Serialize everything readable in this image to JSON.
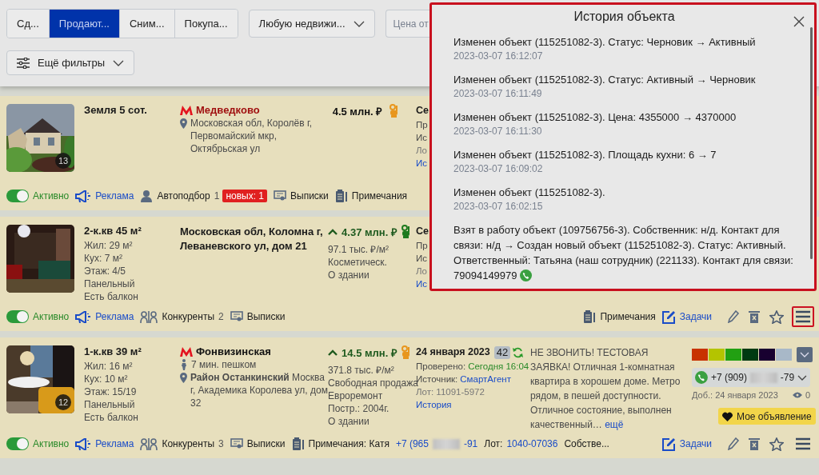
{
  "filters": {
    "tabs": [
      {
        "label": "Сд...",
        "selected": false
      },
      {
        "label": "Продают...",
        "selected": true
      },
      {
        "label": "Сним...",
        "selected": false
      },
      {
        "label": "Покупа...",
        "selected": false
      }
    ],
    "property_type": "Любую недвижи...",
    "price_from": {
      "placeholder": "Цена от"
    },
    "more_filters": "Ещё фильтры"
  },
  "listings": [
    {
      "photo": {
        "kind": "picture",
        "count": "13"
      },
      "title": "Земля 5 сот.",
      "location": {
        "metro": {
          "name": "Медведково",
          "color": "#a01010"
        },
        "address": {
          "kind": "pin",
          "text": "Московская обл, Королёв г, Первомайский мкр, Октябрьская ул"
        }
      },
      "price": {
        "value": "4.5 млн. ₽",
        "rising": false,
        "hand": {
          "color": "#e8961e"
        }
      },
      "info": {
        "date": "Се",
        "checked_label": "Пр",
        "source_label": "Ис",
        "lot": "Ло",
        "history": "Ис"
      },
      "footer": {
        "left": [
          {
            "kind": "status",
            "label": "Активно",
            "on": true
          },
          {
            "kind": "ads",
            "label": "Реклама"
          },
          {
            "kind": "autoselect",
            "label": "Автоподбор",
            "count": "1",
            "badge": "новых: 1"
          },
          {
            "kind": "statements",
            "label": "Выписки"
          },
          {
            "kind": "notes",
            "label": "Примечания"
          }
        ]
      }
    },
    {
      "photo": {
        "kind": "picture"
      },
      "title": "2-к.кв 45 м²",
      "details": [
        "Жил: 29 м²",
        "Кух: 7 м²",
        "Этаж: 4/5",
        "Панельный",
        "Есть балкон"
      ],
      "location": {
        "address": {
          "kind": "heading",
          "text": "Московская обл, Коломна г, Леваневского ул, дом 21"
        }
      },
      "price": {
        "value": "4.37 млн. ₽",
        "rising": true,
        "hand": {
          "color": "#1e7a1e"
        },
        "lines": [
          "97.1 тыс. ₽/м²",
          "Косметическ.",
          "О здании"
        ]
      },
      "info": {
        "date": "Се",
        "checked_label": "Пр",
        "source_label": "Ис",
        "lot": "Ло",
        "history": "Ис"
      },
      "footer": {
        "left": [
          {
            "kind": "status",
            "label": "Активно",
            "on": true
          },
          {
            "kind": "ads",
            "label": "Реклама"
          },
          {
            "kind": "competitors",
            "label": "Конкуренты",
            "count": "2"
          },
          {
            "kind": "statements",
            "label": "Выписки"
          }
        ],
        "right": [
          {
            "kind": "notes",
            "label": "Примечания"
          },
          {
            "kind": "tasks",
            "label": "Задачи"
          }
        ]
      },
      "actions": {
        "menu_highlighted": true
      }
    },
    {
      "photo": {
        "kind": "picture",
        "count": "12"
      },
      "title": "1-к.кв 39 м²",
      "details": [
        "Жил: 16 м²",
        "Кух: 10 м²",
        "Этаж: 15/19",
        "Панельный",
        "Есть балкон"
      ],
      "location": {
        "metro": {
          "name": "Фонвизинская",
          "color": "#111111"
        },
        "walk": "7 мин. пешком",
        "address": {
          "kind": "pin",
          "text": "**Район Останкинский** Москва г, Академика Королева ул, дом 32"
        }
      },
      "price": {
        "value": "14.5 млн. ₽",
        "rising": true,
        "hand": {
          "color": "#e8961e"
        },
        "lines": [
          "371.8 тыс. ₽/м²",
          "Свободная продажа",
          "Евроремонт",
          "Постр.: 2004г.",
          "О здании"
        ]
      },
      "info": {
        "date": "24 января 2023",
        "views": "42",
        "checked_label": "Проверено:",
        "checked_value": "Сегодня 16:04",
        "source_label": "Источник:",
        "source_value": "СмартАгент",
        "lot": "Лот: 11091-5972",
        "history": "История"
      },
      "description": {
        "text": "НЕ ЗВОНИТЬ! ТЕСТОВАЯ ЗАЯВКА! Отличная 1-комнатная квартира в хорошем доме. Метро рядом, в пешей доступности. Отличное состояние, выполнен качественный…",
        "more": "ещё"
      },
      "contact": {
        "colors": [
          {
            "color": "#c83200"
          },
          {
            "color": "#b4c400"
          },
          {
            "color": "#22a012"
          },
          {
            "color": "#003a12"
          },
          {
            "color": "#180030"
          },
          {
            "color": "#a8b8c8"
          }
        ],
        "phone_prefix": "+7 (909)",
        "phone_suffix": "-79",
        "added": "Доб.: 24 января 2023",
        "views": "0",
        "favorite": "Мое объявление"
      },
      "footer": {
        "left": [
          {
            "kind": "status",
            "label": "Активно",
            "on": true
          },
          {
            "kind": "ads",
            "label": "Реклама"
          },
          {
            "kind": "competitors",
            "label": "Конкуренты",
            "count": "3"
          },
          {
            "kind": "statements",
            "label": "Выписки"
          },
          {
            "kind": "notes",
            "label": "Примечания: Катя"
          },
          {
            "kind": "phone",
            "prefix": "+7 (965",
            "suffix": "-91"
          },
          {
            "kind": "lot",
            "label": "Лот:",
            "value": "1040-07036"
          },
          {
            "kind": "owner",
            "label": "Собстве..."
          }
        ],
        "right": [
          {
            "kind": "tasks",
            "label": "Задачи"
          }
        ]
      },
      "actions": {
        "menu_highlighted": false
      }
    }
  ],
  "history": {
    "title": "История объекта",
    "entries": [
      {
        "text": "Изменен объект (115251082-3). Статус: Черновик → Активный",
        "time": "2023-03-07 16:12:07"
      },
      {
        "text": "Изменен объект (115251082-3). Статус: Активный → Черновик",
        "time": "2023-03-07 16:11:49"
      },
      {
        "text": "Изменен объект (115251082-3). Цена: 4355000 → 4370000",
        "time": "2023-03-07 16:11:30"
      },
      {
        "text": "Изменен объект (115251082-3). Площадь кухни: 6 → 7",
        "time": "2023-03-07 16:09:02"
      },
      {
        "text": "Изменен объект (115251082-3).",
        "time": "2023-03-07 16:02:15"
      },
      {
        "text": "Взят в работу объект (109756756-3). Собственник: н/д. Контакт для связи: н/д → Создан новый объект (115251082-3). Статус: Активный. Ответственный: Татьяна (наш сотрудник) (221133). Контакт для связи: 79094149979",
        "phone": true
      }
    ]
  }
}
